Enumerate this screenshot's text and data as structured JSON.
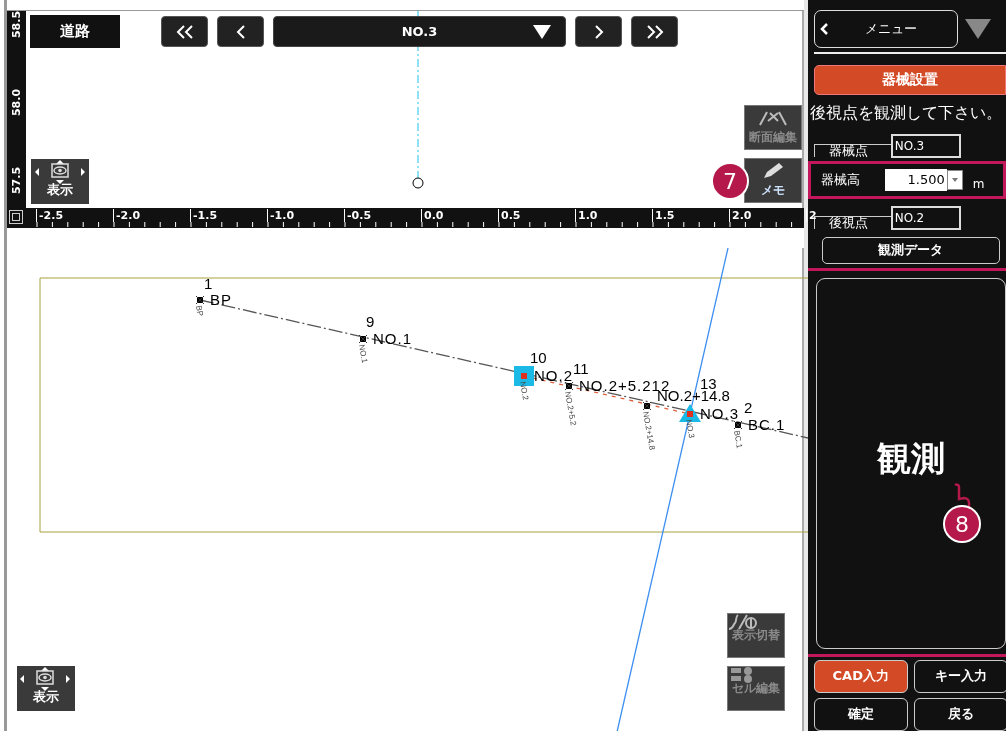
{
  "profile_view": {
    "road_label": "道路",
    "station": "NO.3",
    "vertical_ruler": [
      "58.5",
      "58.0",
      "57.5"
    ],
    "display_control": "表示",
    "tools": [
      {
        "label": "断面編集",
        "disabled": true
      },
      {
        "label": "メモ",
        "disabled": false
      }
    ]
  },
  "horizontal_ruler": [
    "-2.5",
    "-2.0",
    "-1.5",
    "-1.0",
    "-0.5",
    "0.0",
    "0.5",
    "1.0",
    "1.5",
    "2.0",
    "2"
  ],
  "plan_view": {
    "points": [
      {
        "number": "1",
        "name": "BP",
        "tag": "BP",
        "kind": "point"
      },
      {
        "number": "9",
        "name": "NO.1",
        "tag": "NO.1",
        "kind": "point"
      },
      {
        "number": "10",
        "name": "NO.2",
        "tag": "NO.2",
        "kind": "square"
      },
      {
        "number": "11",
        "name": "NO.2+5.212",
        "tag": "NO.2+5.2",
        "kind": "point"
      },
      {
        "name": "NO.2+14.8",
        "tag": "NO.2+14.8",
        "kind": "point"
      },
      {
        "number": "13",
        "name": "NO.3",
        "tag": "NO.3",
        "kind": "triangle"
      },
      {
        "number": "2",
        "name": "BC.1",
        "tag": "BC.1",
        "kind": "point"
      }
    ],
    "display_control": "表示",
    "tools": [
      {
        "label": "表示切替",
        "disabled": true
      },
      {
        "label": "セル編集",
        "disabled": true
      }
    ]
  },
  "panel": {
    "menu": "メニュー",
    "mode": "器械設置",
    "message": "後視点を観測して下さい。",
    "fields": [
      {
        "label": "器械点",
        "value": "NO.3",
        "kind": "text",
        "highlighted": false
      },
      {
        "label": "器械高",
        "value": "1.500",
        "unit": "m",
        "kind": "combo",
        "highlighted": true
      },
      {
        "label": "後視点",
        "value": "NO.2",
        "kind": "text",
        "highlighted": false
      }
    ],
    "data_button": "観測データ",
    "observe_button": {
      "label": "観測",
      "highlighted": true
    },
    "input_tabs": [
      {
        "label": "CAD入力",
        "selected": true
      },
      {
        "label": "キー入力",
        "selected": false
      }
    ],
    "actions": [
      "確定",
      "戻る"
    ]
  },
  "callouts": [
    {
      "number": "7"
    },
    {
      "number": "8"
    }
  ]
}
